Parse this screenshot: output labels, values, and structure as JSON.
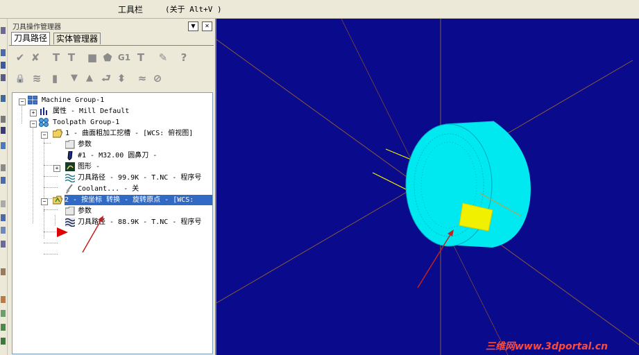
{
  "topbar": {
    "title": "工具栏",
    "hint": "(关于 Alt+V )"
  },
  "panel": {
    "title": "刀具操作管理器",
    "tabs": [
      {
        "label": "刀具路径",
        "active": true
      },
      {
        "label": "实体管理器",
        "active": false
      }
    ],
    "toolbar_row1": [
      {
        "icon": "select-all-icon",
        "glyph": "✔"
      },
      {
        "icon": "select-invalid-icon",
        "glyph": "✘"
      },
      {
        "icon": "regenerate-icon",
        "glyph": "T"
      },
      {
        "icon": "regenerate-dirty-icon",
        "glyph": "T"
      },
      {
        "icon": "backplot-icon",
        "glyph": "■"
      },
      {
        "icon": "verify-icon",
        "glyph": "⬟"
      },
      {
        "icon": "post-icon",
        "glyph": "G1"
      },
      {
        "icon": "high-speed-icon",
        "glyph": "T"
      },
      {
        "icon": "delete-icon",
        "glyph": "✎"
      },
      {
        "icon": "help-icon",
        "glyph": "?"
      }
    ],
    "toolbar_row2": [
      {
        "icon": "lock-icon",
        "glyph": "🔒"
      },
      {
        "icon": "toggle-display-icon",
        "glyph": "≋"
      },
      {
        "icon": "post-toggle-icon",
        "glyph": "▮"
      },
      {
        "icon": "move-down-icon",
        "glyph": "▼"
      },
      {
        "icon": "move-up-icon",
        "glyph": "▲"
      },
      {
        "icon": "insert-arrow-icon",
        "glyph": "⮐"
      },
      {
        "icon": "scroll-icon",
        "glyph": "⬍"
      },
      {
        "icon": "only-display-icon",
        "glyph": "≈"
      },
      {
        "icon": "display-selected-icon",
        "glyph": "⊘"
      }
    ]
  },
  "tree": {
    "nodes": [
      {
        "label": "Machine Group-1",
        "icon": "machine-group-icon"
      },
      {
        "label": "属性 - Mill Default",
        "icon": "properties-icon"
      },
      {
        "label": "Toolpath Group-1",
        "icon": "toolpath-group-icon"
      },
      {
        "label": "1 - 曲面粗加工挖槽 - [WCS: 俯视图]",
        "icon": "folder-open-icon"
      },
      {
        "label": "参数",
        "icon": "parameters-icon"
      },
      {
        "label": "#1 - M32.00 圆鼻刀 -",
        "icon": "tool-icon"
      },
      {
        "label": "图形 -",
        "icon": "geometry-icon"
      },
      {
        "label": "刀具路径 - 99.9K - T.NC - 程序号",
        "icon": "toolpath-wave-icon"
      },
      {
        "label": "Coolant... - 关",
        "icon": "coolant-icon"
      },
      {
        "label": "2 - 按坐标 转换 - 旋转原点 - [WCS:",
        "icon": "folder-open-icon"
      },
      {
        "label": "参数",
        "icon": "parameters-icon"
      },
      {
        "label": "刀具路径 - 88.9K - T.NC - 程序号",
        "icon": "toolpath-wave-icon"
      }
    ],
    "selected_index": 9
  },
  "viewport": {
    "background": "#0a0a8c",
    "part_color": "#00e8f0",
    "highlight_color": "#f0f000",
    "axis_color": "#8a5a3a"
  },
  "watermark": "三维网www.3dportal.cn"
}
